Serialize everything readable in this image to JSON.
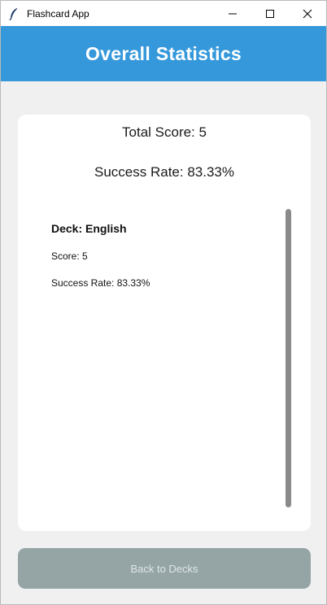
{
  "window": {
    "title": "Flashcard App",
    "icon": "feather-icon"
  },
  "header": {
    "title": "Overall Statistics",
    "background": "#3498db"
  },
  "stats": {
    "total_score": "Total Score: 5",
    "success_rate": "Success Rate: 83.33%"
  },
  "decks": [
    {
      "name": "Deck: English",
      "score": "Score: 5",
      "success_rate": "Success Rate: 83.33%"
    }
  ],
  "footer": {
    "back_label": "Back to Decks",
    "button_color": "#95a5a6"
  }
}
